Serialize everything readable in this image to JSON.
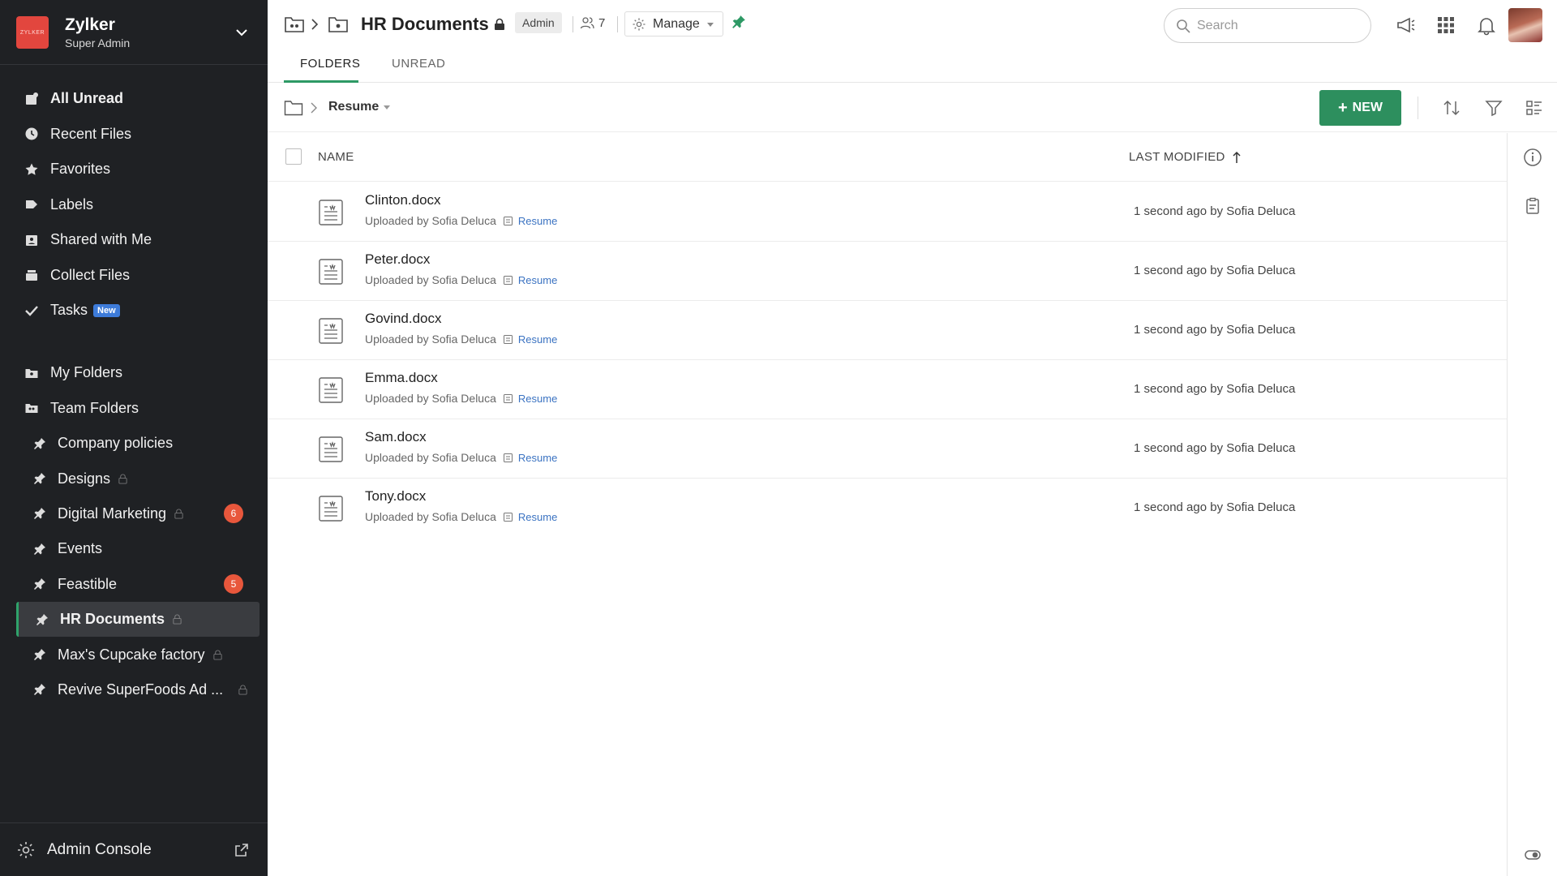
{
  "org": {
    "name": "Zylker",
    "role": "Super Admin",
    "logo_text": "ZYLKER"
  },
  "nav": {
    "items": [
      {
        "label": "All Unread",
        "icon": "all-unread-icon",
        "bold": true
      },
      {
        "label": "Recent Files",
        "icon": "clock-icon"
      },
      {
        "label": "Favorites",
        "icon": "star-icon"
      },
      {
        "label": "Labels",
        "icon": "label-icon"
      },
      {
        "label": "Shared with Me",
        "icon": "shared-icon"
      },
      {
        "label": "Collect Files",
        "icon": "collect-icon"
      },
      {
        "label": "Tasks",
        "icon": "check-icon",
        "badge": "New"
      }
    ],
    "my_folders": "My Folders",
    "team_folders": "Team Folders"
  },
  "team_folders": [
    {
      "label": "Company policies",
      "locked": false
    },
    {
      "label": "Designs",
      "locked": true
    },
    {
      "label": "Digital Marketing",
      "locked": true,
      "count": "6"
    },
    {
      "label": "Events",
      "locked": false
    },
    {
      "label": "Feastible",
      "locked": false,
      "count": "5"
    },
    {
      "label": "HR Documents",
      "locked": true,
      "active": true
    },
    {
      "label": "Max's Cupcake factory",
      "locked": true
    },
    {
      "label": "Revive SuperFoods Ad ...",
      "locked": true
    }
  ],
  "admin_console": "Admin Console",
  "header": {
    "title": "HR Documents",
    "role_badge": "Admin",
    "members": "7",
    "manage": "Manage",
    "search_placeholder": "Search"
  },
  "tabs": [
    "FOLDERS",
    "UNREAD"
  ],
  "toolbar": {
    "breadcrumb": "Resume",
    "new_label": "NEW"
  },
  "table": {
    "col_name": "NAME",
    "col_modified": "LAST MODIFIED",
    "rows": [
      {
        "name": "Clinton.docx",
        "uploaded": "Uploaded by Sofia Deluca",
        "tag": "Resume",
        "modified": "1 second ago by Sofia Deluca"
      },
      {
        "name": "Peter.docx",
        "uploaded": "Uploaded by Sofia Deluca",
        "tag": "Resume",
        "modified": "1 second ago by Sofia Deluca"
      },
      {
        "name": "Govind.docx",
        "uploaded": "Uploaded by Sofia Deluca",
        "tag": "Resume",
        "modified": "1 second ago by Sofia Deluca"
      },
      {
        "name": "Emma.docx",
        "uploaded": "Uploaded by Sofia Deluca",
        "tag": "Resume",
        "modified": "1 second ago by Sofia Deluca"
      },
      {
        "name": "Sam.docx",
        "uploaded": "Uploaded by Sofia Deluca",
        "tag": "Resume",
        "modified": "1 second ago by Sofia Deluca"
      },
      {
        "name": "Tony.docx",
        "uploaded": "Uploaded by Sofia Deluca",
        "tag": "Resume",
        "modified": "1 second ago by Sofia Deluca"
      }
    ]
  },
  "colors": {
    "accent": "#2d8f5e",
    "sidebar_bg": "#1f2124",
    "badge": "#e8573c",
    "link": "#3b73c2"
  }
}
